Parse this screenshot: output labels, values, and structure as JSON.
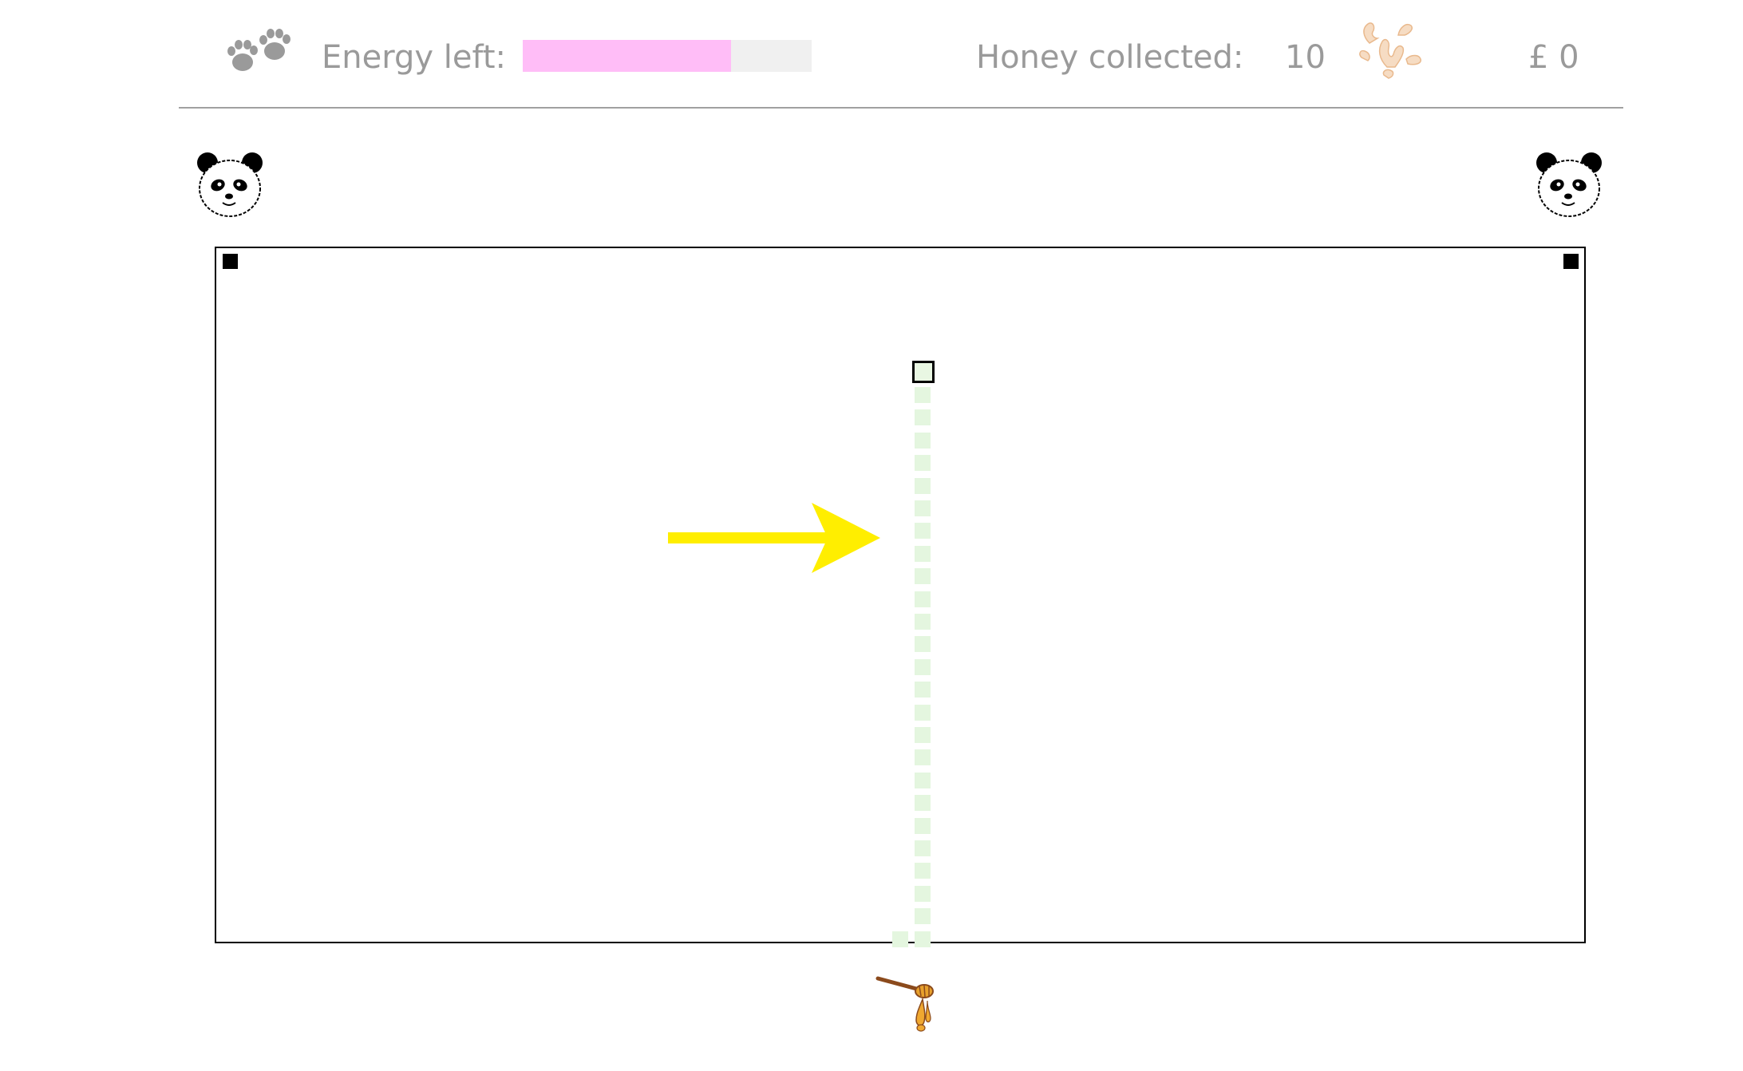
{
  "header": {
    "energy_label": "Energy left:",
    "energy_fraction": 0.72,
    "energy_color": "#ffbdf7",
    "honey_label": "Honey collected:",
    "honey_count": "10",
    "money": "£ 0",
    "icons": {
      "paws": "paws-icon",
      "splash": "honey-splash-icon"
    }
  },
  "board": {
    "trail_rows": 25,
    "trail_color": "#e4f6df",
    "target_color": "#000000"
  },
  "arrow": {
    "color": "#ffee00",
    "direction": "right"
  },
  "icons": {
    "panda_left": "panda-icon",
    "panda_right": "panda-icon",
    "dipper": "honey-dipper-icon"
  }
}
